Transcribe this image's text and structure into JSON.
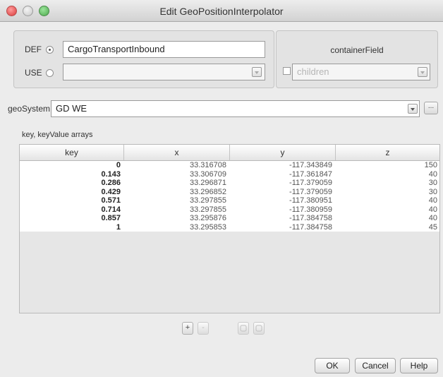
{
  "window": {
    "title": "Edit GeoPositionInterpolator"
  },
  "def_use": {
    "def_label": "DEF",
    "def_value": "CargoTransportInbound",
    "use_label": "USE",
    "use_value": ""
  },
  "container_field": {
    "title": "containerField",
    "value": "children"
  },
  "geo_system": {
    "label": "geoSystem",
    "value": "GD WE",
    "more_label": "..."
  },
  "table": {
    "caption": "key, keyValue arrays",
    "columns": [
      "key",
      "x",
      "y",
      "z"
    ],
    "rows": [
      [
        "0",
        "33.316708",
        "-117.343849",
        "150"
      ],
      [
        "0.143",
        "33.306709",
        "-117.361847",
        "40"
      ],
      [
        "0.286",
        "33.296871",
        "-117.379059",
        "30"
      ],
      [
        "0.429",
        "33.296852",
        "-117.379059",
        "30"
      ],
      [
        "0.571",
        "33.297855",
        "-117.380951",
        "40"
      ],
      [
        "0.714",
        "33.297855",
        "-117.380959",
        "40"
      ],
      [
        "0.857",
        "33.295876",
        "-117.384758",
        "40"
      ],
      [
        "1",
        "33.295853",
        "-117.384758",
        "45"
      ]
    ]
  },
  "table_buttons": {
    "add": "+",
    "remove": "-"
  },
  "buttons": {
    "ok": "OK",
    "cancel": "Cancel",
    "help": "Help"
  },
  "icons": {
    "close": "close-window-icon",
    "minimize": "minimize-window-icon",
    "zoom": "zoom-window-icon",
    "dropdown": "chevron-down-icon",
    "move_up": "move-up-icon",
    "move_down": "move-down-icon"
  },
  "colors": {
    "window_bg": "#ececec",
    "close_red": "#d93a3a",
    "zoom_green": "#4ea94e"
  }
}
